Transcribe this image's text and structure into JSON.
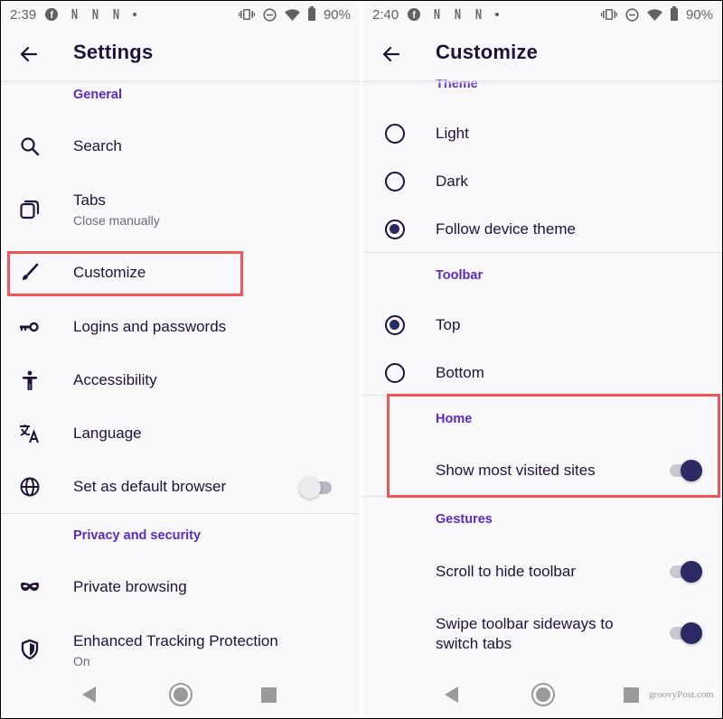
{
  "left": {
    "status": {
      "time": "2:39",
      "battery": "90%",
      "notification_icons": [
        "facebook-icon",
        "netflix-icon",
        "netflix-icon",
        "netflix-icon",
        "more-dot-icon"
      ],
      "system_icons": [
        "vibrate-icon",
        "do-not-disturb-icon",
        "wifi-icon",
        "battery-icon"
      ]
    },
    "appbar": {
      "title": "Settings",
      "back_icon": "back-arrow-icon"
    },
    "sections": [
      {
        "header": "General",
        "items": [
          {
            "label": "Search",
            "icon": "search-icon"
          },
          {
            "label": "Tabs",
            "sub": "Close manually",
            "icon": "tabs-icon"
          },
          {
            "label": "Customize",
            "icon": "paintbrush-icon",
            "highlighted": true
          },
          {
            "label": "Logins and passwords",
            "icon": "key-icon"
          },
          {
            "label": "Accessibility",
            "icon": "accessibility-icon"
          },
          {
            "label": "Language",
            "icon": "translate-icon"
          },
          {
            "label": "Set as default browser",
            "icon": "globe-icon",
            "toggle": false
          }
        ]
      },
      {
        "header": "Privacy and security",
        "items": [
          {
            "label": "Private browsing",
            "icon": "mask-icon"
          },
          {
            "label": "Enhanced Tracking Protection",
            "sub": "On",
            "icon": "shield-icon"
          }
        ]
      }
    ]
  },
  "right": {
    "status": {
      "time": "2:40",
      "battery": "90%"
    },
    "appbar": {
      "title": "Customize",
      "back_icon": "back-arrow-icon"
    },
    "theme": {
      "header": "Theme",
      "options": [
        {
          "label": "Light",
          "checked": false
        },
        {
          "label": "Dark",
          "checked": false
        },
        {
          "label": "Follow device theme",
          "checked": true
        }
      ]
    },
    "toolbar": {
      "header": "Toolbar",
      "options": [
        {
          "label": "Top",
          "checked": true
        },
        {
          "label": "Bottom",
          "checked": false
        }
      ]
    },
    "home": {
      "header": "Home",
      "items": [
        {
          "label": "Show most visited sites",
          "toggle": true
        }
      ]
    },
    "gestures": {
      "header": "Gestures",
      "items": [
        {
          "label": "Scroll to hide toolbar",
          "toggle": true
        },
        {
          "label": "Swipe toolbar sideways to switch tabs",
          "line1": "Swipe toolbar sideways to",
          "line2": "switch tabs",
          "toggle": true
        }
      ]
    }
  },
  "watermark": "groovyPost.com",
  "colors": {
    "accent": "#592acb",
    "text": "#20123a",
    "toggle_on": "#2b2a65",
    "highlight": "#f25555"
  }
}
